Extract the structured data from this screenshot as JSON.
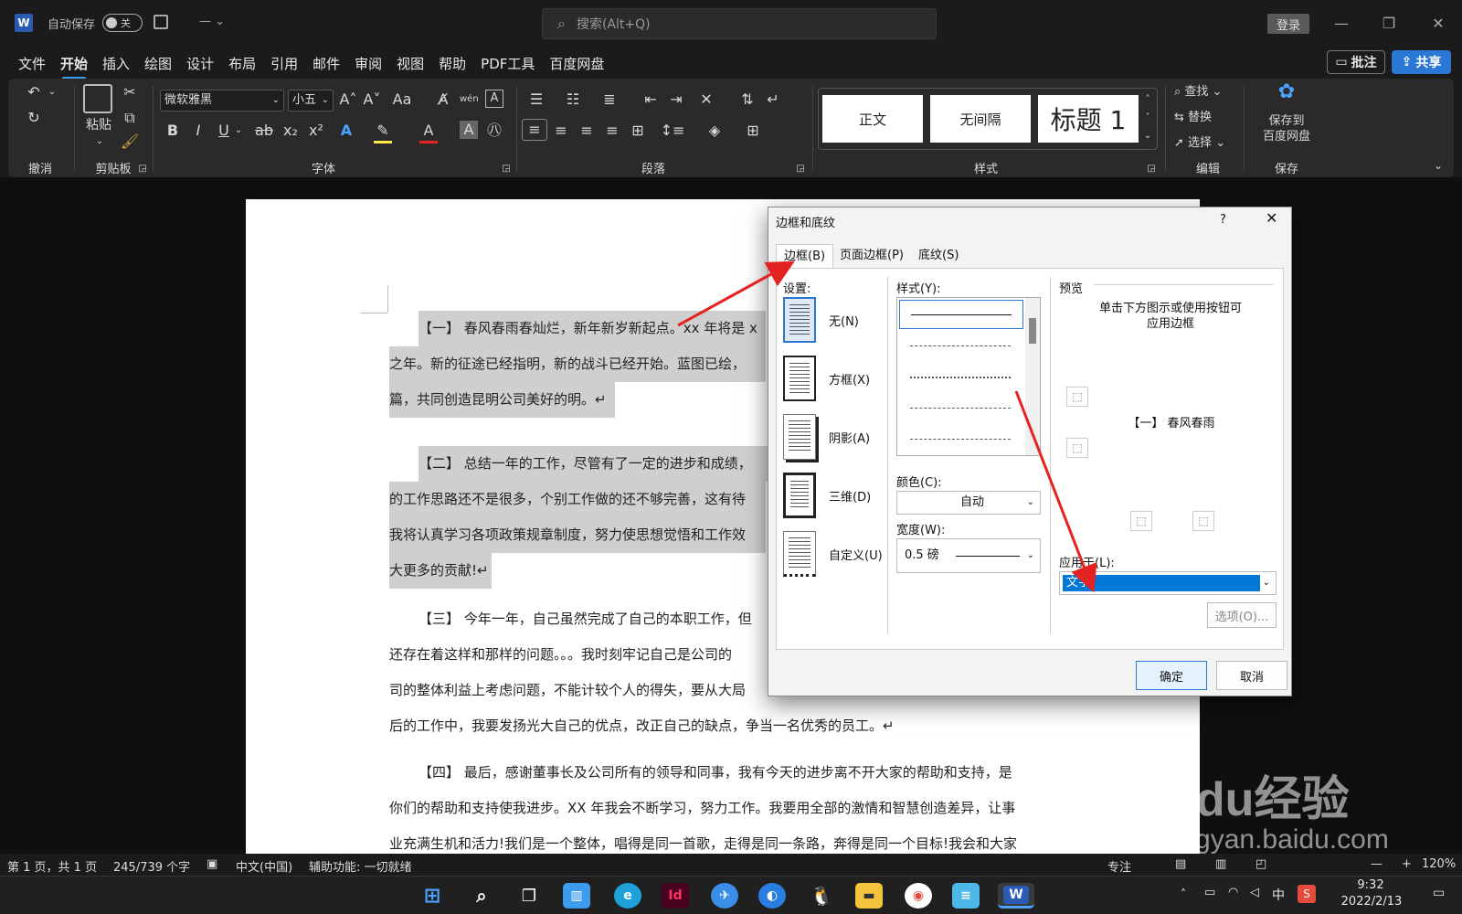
{
  "titlebar": {
    "autosave_label": "自动保存",
    "autosave_state": "关",
    "doc_name": "— ⌄",
    "search_placeholder": "搜索(Alt+Q)",
    "login_label": "登录"
  },
  "menu": {
    "tabs": [
      "文件",
      "开始",
      "插入",
      "绘图",
      "设计",
      "布局",
      "引用",
      "邮件",
      "审阅",
      "视图",
      "帮助",
      "PDF工具",
      "百度网盘"
    ],
    "active": "开始",
    "comment_label": "批注",
    "share_label": "共享"
  },
  "ribbon": {
    "groups": {
      "undo": "撤消",
      "clipboard": "剪贴板",
      "font": "字体",
      "paragraph": "段落",
      "styles": "样式",
      "editing": "编辑",
      "save": "保存"
    },
    "paste_label": "粘贴",
    "font_name": "微软雅黑",
    "font_size": "小五",
    "styles": [
      "正文",
      "无间隔",
      "标题 1"
    ],
    "find_label": "查找",
    "replace_label": "替换",
    "select_label": "选择",
    "baidu_save_label": "保存到\n百度网盘"
  },
  "document": {
    "paragraphs": [
      {
        "lines": [
          "【一】 春风春雨春灿烂，新年新岁新起点。xx 年将是 x",
          "之年。新的征途已经指明，新的战斗已经开始。蓝图已绘，",
          "篇，共同创造昆明公司美好的明。↵"
        ]
      },
      {
        "lines": [
          "【二】 总结一年的工作，尽管有了一定的进步和成绩，",
          "的工作思路还不是很多，个别工作做的还不够完善，这有待",
          "我将认真学习各项政策规章制度，努力使思想觉悟和工作效",
          "大更多的贡献!↵"
        ]
      },
      {
        "lines": [
          "【三】 今年一年，自己虽然完成了自己的本职工作，但",
          "还存在着这样和那样的问题。。。我时刻牢记自己是公司的",
          "司的整体利益上考虑问题，不能计较个人的得失，要从大局",
          "后的工作中，我要发扬光大自己的优点，改正自己的缺点，争当一名优秀的员工。↵"
        ]
      },
      {
        "lines": [
          "【四】 最后，感谢董事长及公司所有的领导和同事，我有今天的进步离不开大家的帮助和支持，是",
          "你们的帮助和支持使我进步。XX 年我会不断学习，努力工作。我要用全部的激情和智慧创造差异，让事",
          "业充满生机和活力!我们是一个整体，唱得是同一首歌，走得是同一条路，奔得是同一个目标!我会和大家"
        ]
      }
    ]
  },
  "dialog": {
    "title": "边框和底纹",
    "help": "?",
    "tabs": [
      "边框(B)",
      "页面边框(P)",
      "底纹(S)"
    ],
    "settings_label": "设置:",
    "settings": [
      "无(N)",
      "方框(X)",
      "阴影(A)",
      "三维(D)",
      "自定义(U)"
    ],
    "style_label": "样式(Y):",
    "color_label": "颜色(C):",
    "color_value": "自动",
    "width_label": "宽度(W):",
    "width_value": "0.5 磅",
    "preview_label": "预览",
    "preview_hint": "单击下方图示或使用按钮可\n应用边框",
    "preview_text": "【一】 春风春雨",
    "apply_label": "应用于(L):",
    "apply_value": "文字",
    "options_label": "选项(O)...",
    "ok_label": "确定",
    "cancel_label": "取消"
  },
  "statusbar": {
    "page": "第 1 页，共 1 页",
    "words": "245/739 个字",
    "language": "中文(中国)",
    "accessibility": "辅助功能: 一切就绪",
    "focus": "专注",
    "zoom": "120%"
  },
  "taskbar": {
    "time": "9:32",
    "date": "2022/2/13",
    "ime": "中"
  },
  "watermark": {
    "brand": "Baidu经验",
    "url": "jingyan.baidu.com"
  },
  "colors": {
    "accent": "#2b77d6",
    "arrow": "#e52222",
    "selection": "#0078d7"
  }
}
